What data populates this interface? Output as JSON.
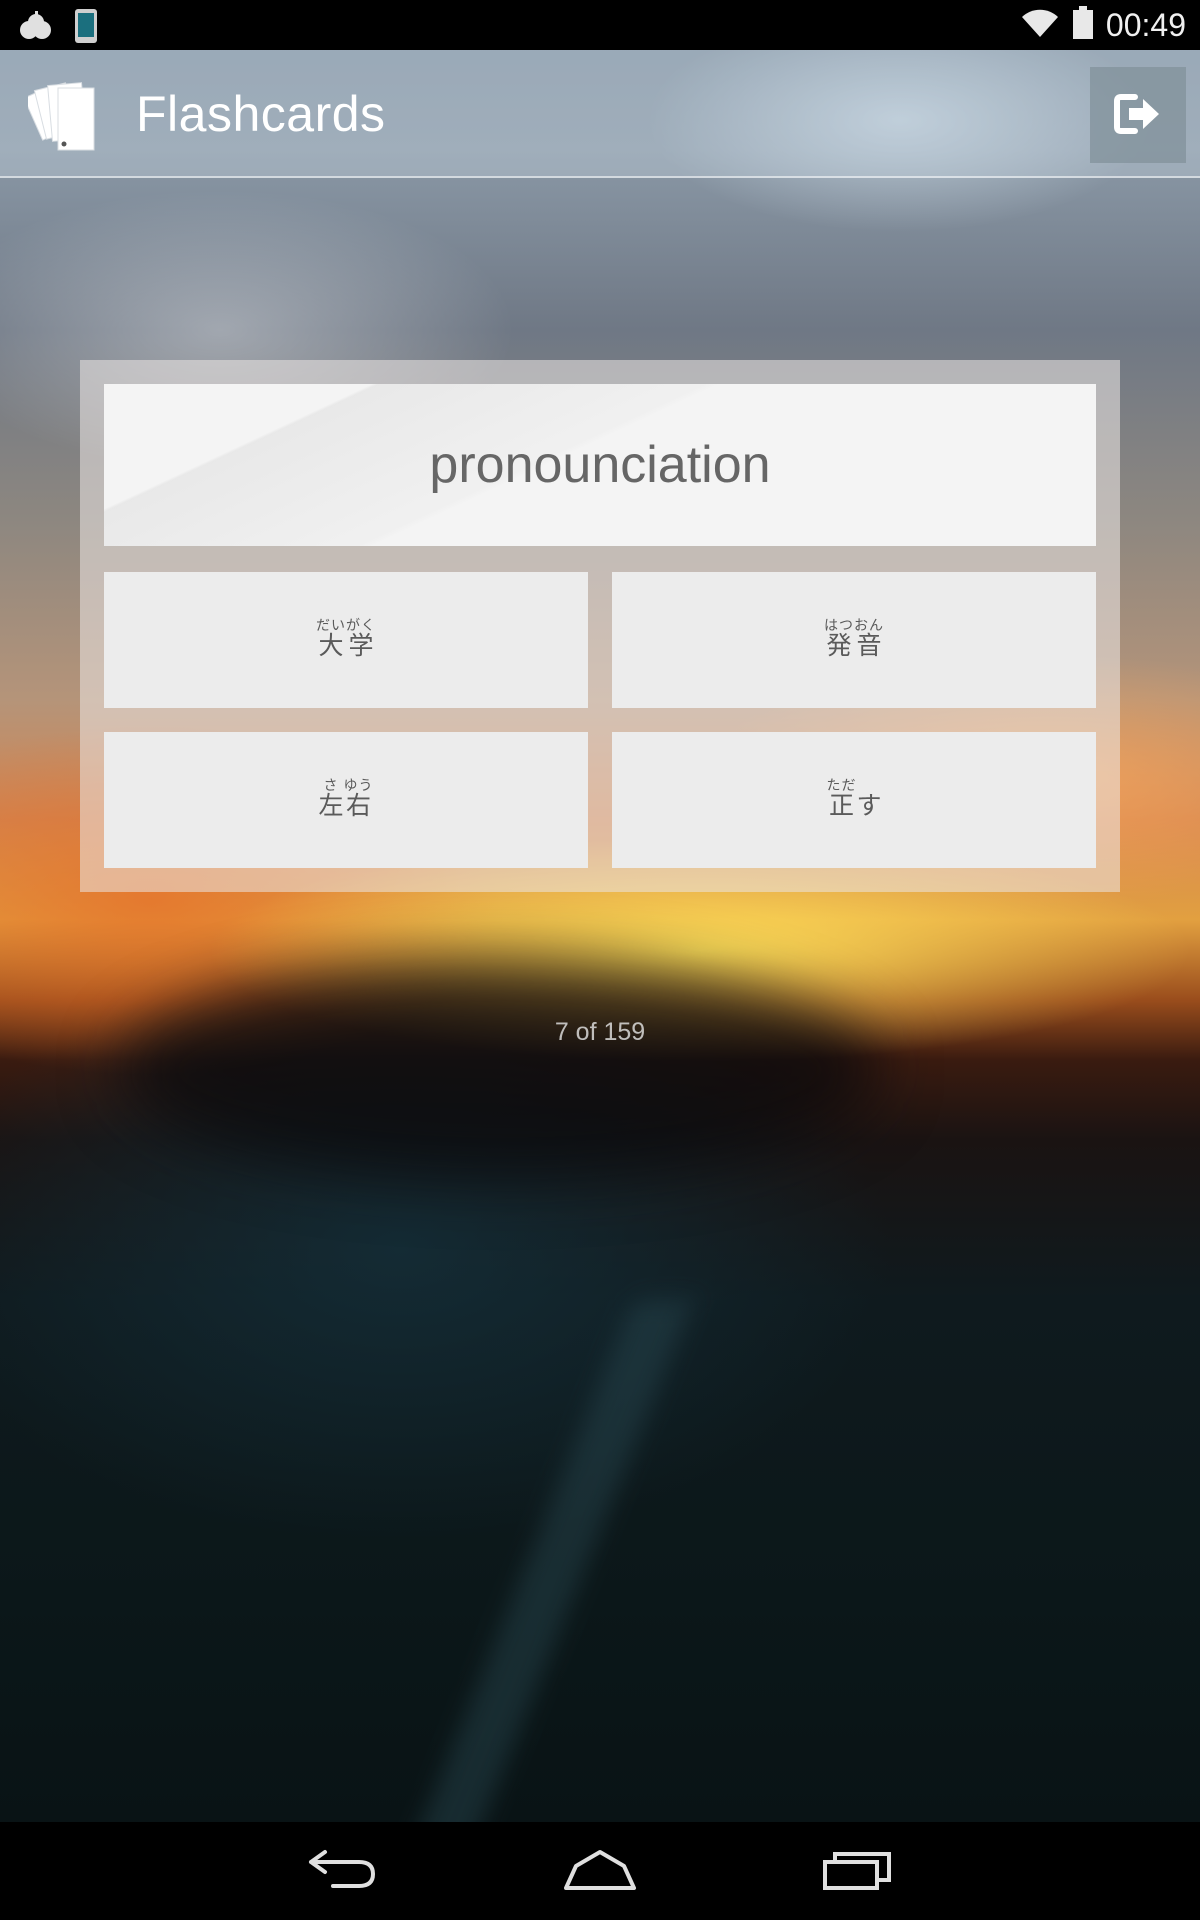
{
  "status_bar": {
    "time": "00:49",
    "icons": [
      "notification-cloud-icon",
      "tablet-icon",
      "wifi-icon",
      "battery-icon"
    ]
  },
  "action_bar": {
    "title": "Flashcards",
    "icon": "flashcards-stack-icon",
    "exit_icon": "exit-icon"
  },
  "card": {
    "question": "pronounciation",
    "answers": [
      {
        "kanji": "大学",
        "reading": "だいがく"
      },
      {
        "kanji": "発音",
        "reading": "はつおん"
      },
      {
        "kanji_1": "左",
        "reading_1": "さ",
        "kanji_2": "右",
        "reading_2": "ゆう"
      },
      {
        "kanji": "正",
        "reading": "ただ",
        "okurigana": "す"
      }
    ]
  },
  "progress": {
    "text": "7 of 159",
    "current": 7,
    "total": 159
  },
  "nav_bar": {
    "icons": [
      "back-icon",
      "home-icon",
      "recents-icon"
    ]
  },
  "colors": {
    "status_bar": "#000000",
    "card_text": "#666666",
    "answer_bg": "#ececec"
  }
}
